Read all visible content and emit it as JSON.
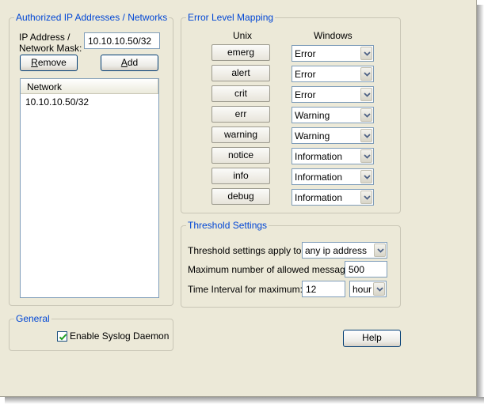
{
  "authorized": {
    "legend": "Authorized IP Addresses / Networks",
    "ip_label_line1": "IP Address /",
    "ip_label_line2": "Network Mask:",
    "ip_value": "10.10.10.50/32",
    "remove_label_ul": "R",
    "remove_label_rest": "emove",
    "add_label_ul": "A",
    "add_label_rest": "dd",
    "list": {
      "column_header": "Network",
      "rows": [
        "10.10.10.50/32"
      ]
    }
  },
  "error_mapping": {
    "legend": "Error Level Mapping",
    "unix_header": "Unix",
    "windows_header": "Windows",
    "rows": [
      {
        "unix": "emerg",
        "windows": "Error"
      },
      {
        "unix": "alert",
        "windows": "Error"
      },
      {
        "unix": "crit",
        "windows": "Error"
      },
      {
        "unix": "err",
        "windows": "Warning"
      },
      {
        "unix": "warning",
        "windows": "Warning"
      },
      {
        "unix": "notice",
        "windows": "Information"
      },
      {
        "unix": "info",
        "windows": "Information"
      },
      {
        "unix": "debug",
        "windows": "Information"
      }
    ]
  },
  "threshold": {
    "legend": "Threshold Settings",
    "apply_label": "Threshold settings apply to",
    "apply_value": "any ip address",
    "max_label": "Maximum number of allowed messages:",
    "max_value": "500",
    "interval_label": "Time Interval for maximum:",
    "interval_value": "12",
    "interval_unit": "hour"
  },
  "general": {
    "legend": "General",
    "enable_label": "Enable Syslog Daemon",
    "enable_checked": true
  },
  "help_label": "Help",
  "icons": {
    "combo_arrow": "chevron-down-icon",
    "checkmark": "checkmark-icon"
  },
  "colors": {
    "window_bg": "#ece9d8",
    "legend_text": "#0046d5",
    "button_border": "#003c74",
    "field_border": "#7f9db9"
  }
}
